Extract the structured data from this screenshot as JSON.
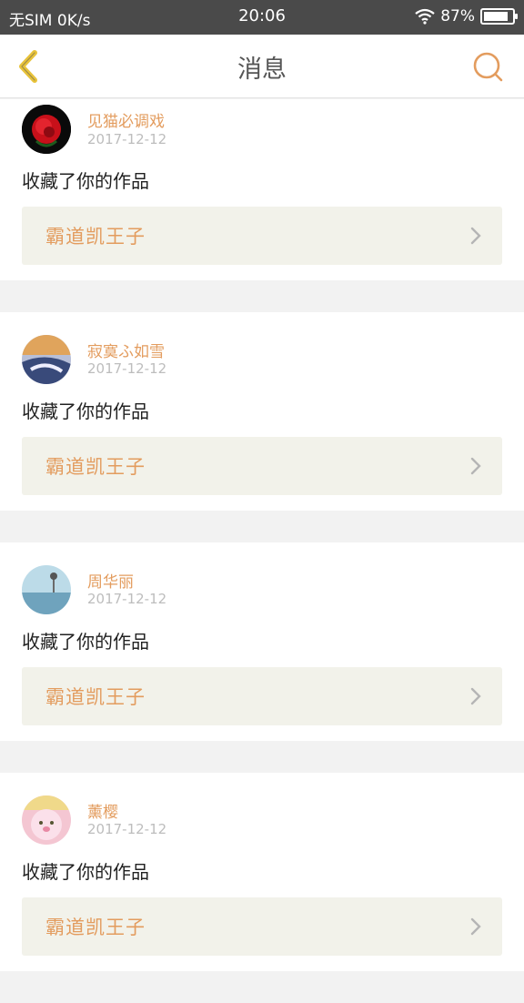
{
  "status": {
    "carrier": "无SIM 0K/s",
    "time": "20:06",
    "battery": "87%",
    "battery_level": 0.87
  },
  "header": {
    "title": "消息"
  },
  "messages": [
    {
      "username": "见猫必调戏",
      "date": "2017-12-12",
      "action": "收藏了你的作品",
      "work_title": "霸道凯王子"
    },
    {
      "username": "寂寞ふ如雪",
      "date": "2017-12-12",
      "action": "收藏了你的作品",
      "work_title": "霸道凯王子"
    },
    {
      "username": "周华丽",
      "date": "2017-12-12",
      "action": "收藏了你的作品",
      "work_title": "霸道凯王子"
    },
    {
      "username": "薰樱",
      "date": "2017-12-12",
      "action": "收藏了你的作品",
      "work_title": "霸道凯王子"
    }
  ],
  "colors": {
    "accent": "#e39c5e",
    "back": "#e8c33a",
    "card_bg": "#f2f2ea"
  }
}
